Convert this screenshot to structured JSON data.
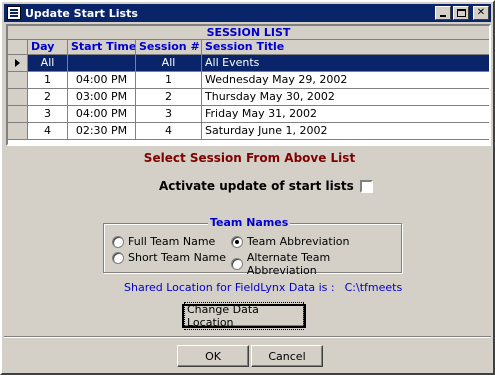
{
  "window": {
    "title": "Update Start Lists"
  },
  "grid": {
    "caption": "SESSION LIST",
    "columns": [
      "Day",
      "Start Time",
      "Session #",
      "Session Title"
    ],
    "rows": [
      {
        "day": "All",
        "time": "",
        "session": "All",
        "title": "All Events"
      },
      {
        "day": "1",
        "time": "04:00 PM",
        "session": "1",
        "title": "Wednesday May 29, 2002"
      },
      {
        "day": "2",
        "time": "03:00 PM",
        "session": "2",
        "title": "Thursday May 30, 2002"
      },
      {
        "day": "3",
        "time": "04:00 PM",
        "session": "3",
        "title": "Friday May 31, 2002"
      },
      {
        "day": "4",
        "time": "02:30 PM",
        "session": "4",
        "title": "Saturday  June 1, 2002"
      }
    ]
  },
  "select_label": "Select Session From Above List",
  "activate_label": "Activate update of start lists",
  "team_names": {
    "legend": "Team Names",
    "options": [
      {
        "label": "Full Team Name",
        "selected": false
      },
      {
        "label": "Team Abbreviation",
        "selected": true
      },
      {
        "label": "Short Team Name",
        "selected": false
      },
      {
        "label": "Alternate Team Abbreviation",
        "selected": false
      }
    ]
  },
  "shared_location": {
    "label": "Shared Location for FieldLynx Data is :",
    "path": "C:\\tfmeets"
  },
  "buttons": {
    "change": "Change Data Location",
    "ok": "OK",
    "cancel": "Cancel"
  }
}
